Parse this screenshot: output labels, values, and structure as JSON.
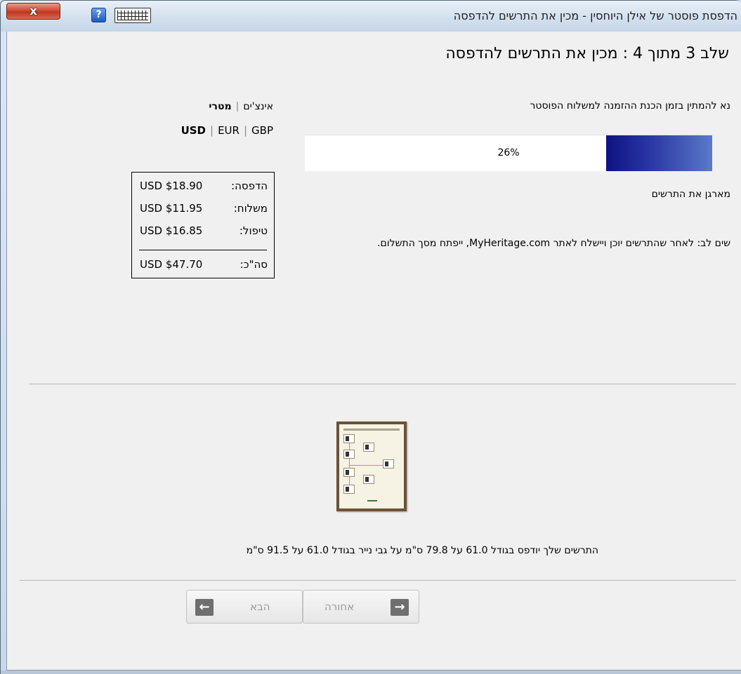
{
  "window": {
    "title": "הדפסת פוסטר של אילן היוחסין - מכין את התרשים להדפסה",
    "close_label": "x",
    "help_label": "?"
  },
  "main": {
    "step_title": "שלב 3 מתוך 4 : מכין את התרשים להדפסה",
    "wait_message": "נא להמתין בזמן הכנת ההזמנה למשלוח הפוסטר",
    "progress": {
      "percent": 26,
      "label": "26%"
    },
    "status": "מארגן את התרשים",
    "note": "שים לב: לאחר שהתרשים יוכן ויישלח לאתר MyHeritage.com, ייפתח מסך התשלום."
  },
  "units": {
    "inches": "אינצ'ים",
    "metric": "מטרי",
    "selected": "metric"
  },
  "currencies": {
    "items": [
      "USD",
      "EUR",
      "GBP"
    ],
    "selected": "USD"
  },
  "pricing": {
    "rows": [
      {
        "label": "הדפסה:",
        "value": "USD $18.90"
      },
      {
        "label": "משלוח:",
        "value": "USD $11.95"
      },
      {
        "label": "טיפול:",
        "value": "USD $16.85"
      }
    ],
    "total": {
      "label": "סה\"כ:",
      "value": "USD $47.70"
    }
  },
  "preview": {
    "size_text": "התרשים שלך יודפס בגודל 61.0 על 79.8 ס\"מ על גבי נייר בגודל 61.0 על 91.5 ס\"מ"
  },
  "nav": {
    "next_label": "הבא",
    "back_label": "אחורה",
    "next_arrow_icon": "arrow-left-icon",
    "back_arrow_icon": "arrow-right-icon"
  },
  "colors": {
    "progress_fill": "#0e1283",
    "close_button": "#c0361e"
  }
}
